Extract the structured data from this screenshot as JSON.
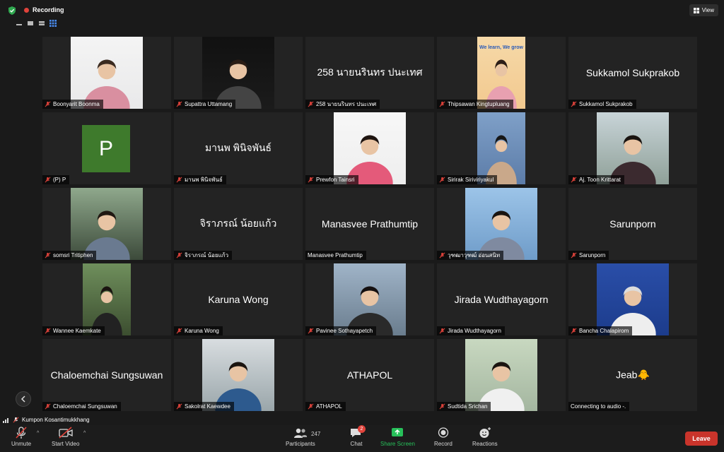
{
  "topbar": {
    "recording_label": "Recording",
    "view_label": "View"
  },
  "tiles": [
    {
      "name": "Boonyarit Boonma",
      "display": "",
      "has_photo": true,
      "muted": true
    },
    {
      "name": "Supattra Uttamang",
      "display": "",
      "has_photo": true,
      "muted": true
    },
    {
      "name": "258 นายนรินทร ปนะเทศ",
      "display": "258 นายนรินทร ปนะเทศ",
      "has_photo": false,
      "muted": true
    },
    {
      "name": "Thipsawan Kingtupluang",
      "display": "",
      "has_photo": true,
      "muted": true,
      "photo_caption": "We learn, We grow"
    },
    {
      "name": "Sukkamol Sukprakob",
      "display": "Sukkamol Sukprakob",
      "has_photo": false,
      "muted": true
    },
    {
      "name": "(P) P",
      "display": "",
      "has_photo": false,
      "muted": true,
      "avatar_letter": "P"
    },
    {
      "name": "มานพ พินิจพันธ์",
      "display": "มานพ พินิจพันธ์",
      "has_photo": false,
      "muted": true
    },
    {
      "name": "Prewfon Tainsri",
      "display": "",
      "has_photo": true,
      "muted": true
    },
    {
      "name": "Sirirak Siriviriyakul",
      "display": "",
      "has_photo": true,
      "muted": true
    },
    {
      "name": "Aj. Toon Krittarat",
      "display": "",
      "has_photo": true,
      "muted": true
    },
    {
      "name": "somsri Tritiphen",
      "display": "",
      "has_photo": true,
      "muted": true
    },
    {
      "name": "จิราภรณ์ น้อยแก้ว",
      "display": "จิราภรณ์ น้อยแก้ว",
      "has_photo": false,
      "muted": true
    },
    {
      "name": "Manasvee Prathumtip",
      "display": "Manasvee Prathumtip",
      "has_photo": false,
      "muted": false
    },
    {
      "name": "วุฑฒาวุฑฒ์ อ่อนสนิท",
      "display": "",
      "has_photo": true,
      "muted": true
    },
    {
      "name": "Sarunporn",
      "display": "Sarunporn",
      "has_photo": false,
      "muted": true
    },
    {
      "name": "Wannee Kaemkate",
      "display": "",
      "has_photo": true,
      "muted": true
    },
    {
      "name": "Karuna Wong",
      "display": "Karuna Wong",
      "has_photo": false,
      "muted": true
    },
    {
      "name": "Pavinee Sothayapetch",
      "display": "",
      "has_photo": true,
      "muted": true
    },
    {
      "name": "Jirada Wudthayagorn",
      "display": "Jirada Wudthayagorn",
      "has_photo": false,
      "muted": true
    },
    {
      "name": "Bancha Chalapirom",
      "display": "",
      "has_photo": true,
      "muted": true
    },
    {
      "name": "Chaloemchai Sungsuwan",
      "display": "Chaloemchai Sungsuwan",
      "has_photo": false,
      "muted": true
    },
    {
      "name": "Sakolrat Kaewdee",
      "display": "",
      "has_photo": true,
      "muted": true
    },
    {
      "name": "ATHAPOL",
      "display": "ATHAPOL",
      "has_photo": false,
      "muted": true
    },
    {
      "name": "Sudtida Srichan",
      "display": "",
      "has_photo": true,
      "muted": true
    },
    {
      "name": "Connecting to audio -.",
      "display": "Jeab🐥",
      "has_photo": false,
      "muted": false
    }
  ],
  "active_speaker": "Kumpon Kosantimukkhang",
  "toolbar": {
    "unmute": "Unmute",
    "start_video": "Start Video",
    "participants": "Participants",
    "participants_count": "247",
    "chat": "Chat",
    "chat_badge": "2",
    "share_screen": "Share Screen",
    "record": "Record",
    "reactions": "Reactions",
    "leave": "Leave"
  },
  "colors": {
    "accent_red": "#c9342b",
    "share_green": "#27c05a",
    "avatar_green": "#3e7a2c"
  }
}
